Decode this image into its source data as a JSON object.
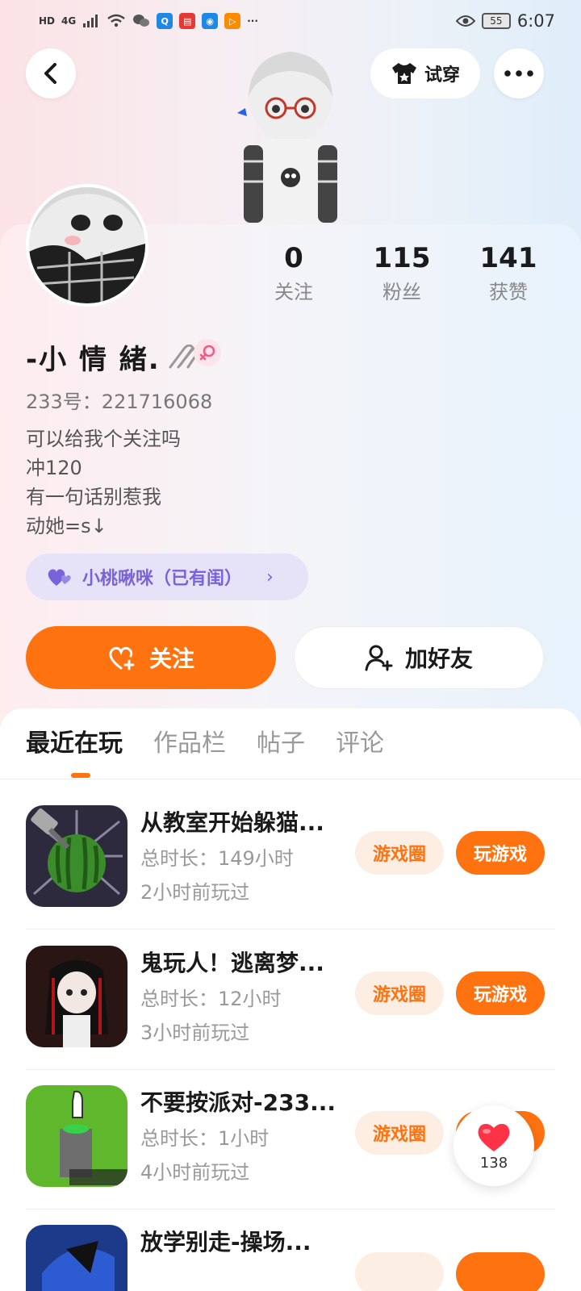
{
  "status_bar": {
    "network": "HD",
    "signal": "4G",
    "battery": "55",
    "time": "6:07"
  },
  "top_bar": {
    "try_on_label": "试穿"
  },
  "profile": {
    "nickname": "-小 情 緒.",
    "uid": "233号：221716068",
    "bio": [
      "可以给我个关注吗",
      "冲120",
      "有一句话别惹我",
      "动她=s↓"
    ],
    "couple_tag": "小桃啾咪（已有闺）",
    "gender": "female",
    "stats": [
      {
        "value": "0",
        "label": "关注"
      },
      {
        "value": "115",
        "label": "粉丝"
      },
      {
        "value": "141",
        "label": "获赞"
      }
    ]
  },
  "actions": {
    "follow_label": "关注",
    "add_friend_label": "加好友"
  },
  "tabs": [
    {
      "label": "最近在玩",
      "active": true
    },
    {
      "label": "作品栏",
      "active": false
    },
    {
      "label": "帖子",
      "active": false
    },
    {
      "label": "评论",
      "active": false
    }
  ],
  "games": [
    {
      "title": "从教室开始躲猫...",
      "duration": "总时长：149小时",
      "last_played": "2小时前玩过",
      "circle_label": "游戏圈",
      "play_label": "玩游戏"
    },
    {
      "title": "鬼玩人！逃离梦...",
      "duration": "总时长：12小时",
      "last_played": "3小时前玩过",
      "circle_label": "游戏圈",
      "play_label": "玩游戏"
    },
    {
      "title": "不要按派对-233...",
      "duration": "总时长：1小时",
      "last_played": "4小时前玩过",
      "circle_label": "游戏圈",
      "play_label": "玩游戏"
    },
    {
      "title": "放学别走-操场...",
      "duration": "",
      "last_played": "",
      "circle_label": "",
      "play_label": ""
    }
  ],
  "like_float": {
    "count": "138"
  },
  "colors": {
    "accent": "#ff7210",
    "accent_soft": "#fdeee3",
    "couple_tag_bg": "#e6e2f7",
    "couple_tag_text": "#7a63d8"
  },
  "icons": {
    "back": "chevron-left-icon",
    "more": "more-dots-icon",
    "try_on": "tshirt-icon",
    "follow": "heart-plus-icon",
    "add_friend": "user-plus-icon",
    "gender": "female-icon",
    "couple": "hearts-icon",
    "like": "heart-icon"
  }
}
